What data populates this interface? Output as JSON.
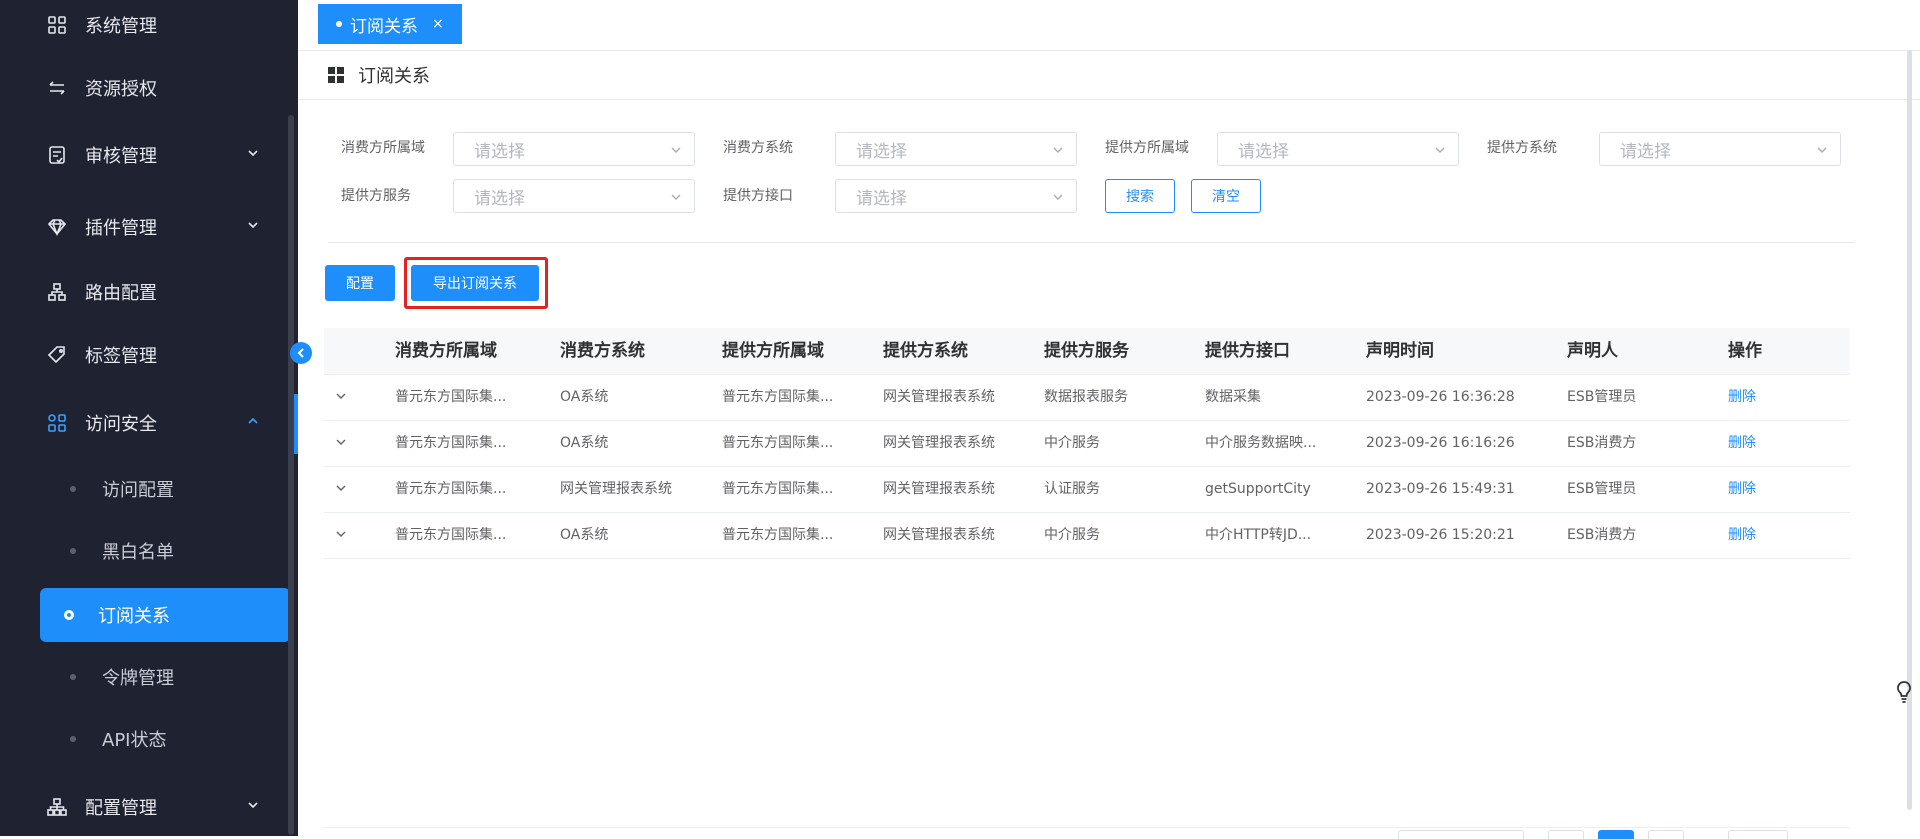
{
  "sidebar": {
    "items": [
      {
        "label": "系统管理",
        "icon": "grid-icon"
      },
      {
        "label": "资源授权",
        "icon": "swap-icon"
      },
      {
        "label": "审核管理",
        "icon": "audit-icon"
      },
      {
        "label": "插件管理",
        "icon": "diamond-icon"
      },
      {
        "label": "路由配置",
        "icon": "org-tree-icon"
      },
      {
        "label": "标签管理",
        "icon": "tag-icon"
      },
      {
        "label": "访问安全",
        "icon": "grid-icon"
      },
      {
        "label": "配置管理",
        "icon": "org-tree-icon"
      }
    ],
    "sub_items": [
      {
        "label": "访问配置"
      },
      {
        "label": "黑白名单"
      },
      {
        "label": "订阅关系"
      },
      {
        "label": "令牌管理"
      },
      {
        "label": "API状态"
      }
    ],
    "accent": "#1e8ffa"
  },
  "tabs": {
    "active_label": "订阅关系",
    "close_glyph": "×"
  },
  "page": {
    "title": "订阅关系"
  },
  "filters": {
    "labels": [
      "消费方所属域",
      "消费方系统",
      "提供方所属域",
      "提供方系统",
      "提供方服务",
      "提供方接口"
    ],
    "placeholder": "请选择",
    "search_label": "搜索",
    "clear_label": "清空"
  },
  "toolbar": {
    "config_label": "配置",
    "export_label": "导出订阅关系"
  },
  "table": {
    "columns": [
      "消费方所属域",
      "消费方系统",
      "提供方所属域",
      "提供方系统",
      "提供方服务",
      "提供方接口",
      "声明时间",
      "声明人",
      "操作"
    ],
    "rows": [
      {
        "c0": "普元东方国际集...",
        "c1": "OA系统",
        "c2": "普元东方国际集...",
        "c3": "网关管理报表系统",
        "c4": "数据报表服务",
        "c5": "数据采集",
        "c6": "2023-09-26 16:36:28",
        "c7": "ESB管理员",
        "action": "删除"
      },
      {
        "c0": "普元东方国际集...",
        "c1": "OA系统",
        "c2": "普元东方国际集...",
        "c3": "网关管理报表系统",
        "c4": "中介服务",
        "c5": "中介服务数据映...",
        "c6": "2023-09-26 16:16:26",
        "c7": "ESB消费方",
        "action": "删除"
      },
      {
        "c0": "普元东方国际集...",
        "c1": "网关管理报表系统",
        "c2": "普元东方国际集...",
        "c3": "网关管理报表系统",
        "c4": "认证服务",
        "c5": "getSupportCity",
        "c6": "2023-09-26 15:49:31",
        "c7": "ESB管理员",
        "action": "删除"
      },
      {
        "c0": "普元东方国际集...",
        "c1": "OA系统",
        "c2": "普元东方国际集...",
        "c3": "网关管理报表系统",
        "c4": "中介服务",
        "c5": "中介HTTP转JD...",
        "c6": "2023-09-26 15:20:21",
        "c7": "ESB消费方",
        "action": "删除"
      }
    ]
  }
}
